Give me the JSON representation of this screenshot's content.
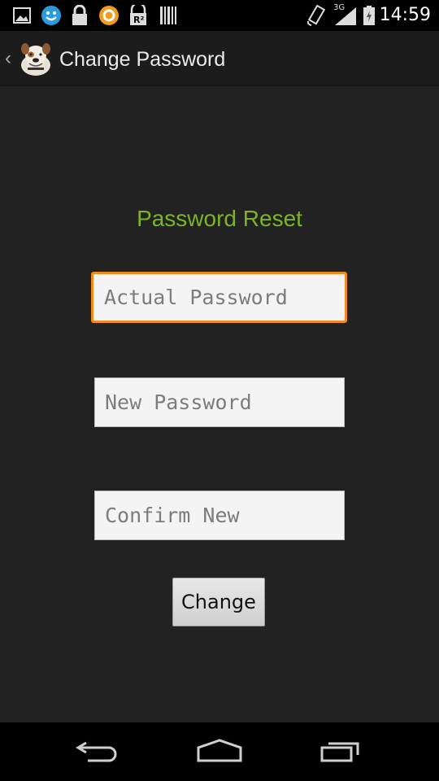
{
  "status_bar": {
    "time": "14:59",
    "network_label": "3G",
    "icons": [
      "image-icon",
      "smiley-icon",
      "lock-icon",
      "sync-icon",
      "r2-icon",
      "barcode-icon",
      "rotate-icon",
      "signal-icon",
      "battery-icon"
    ]
  },
  "action_bar": {
    "title": "Change Password",
    "icon": "bulldog-app-icon"
  },
  "form": {
    "heading": "Password Reset",
    "heading_color": "#7cb32a",
    "actual_password_placeholder": "Actual Password",
    "new_password_placeholder": "New Password",
    "confirm_placeholder": "Confirm New",
    "focus_color": "#f28a1c",
    "submit_label": "Change"
  },
  "nav_bar": {
    "buttons": [
      "back-icon",
      "home-icon",
      "recents-icon"
    ]
  }
}
